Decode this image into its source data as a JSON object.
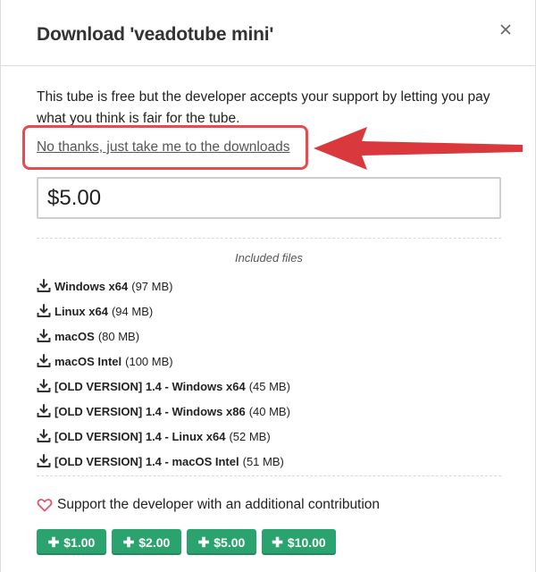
{
  "dialog": {
    "title": "Download 'veadotube mini'",
    "close_icon": "close-icon",
    "description": "This tube is free but the developer accepts your support by letting you pay what you think is fair for the tube.",
    "skip_link": "No thanks, just take me to the downloads",
    "price_value": "$5.00",
    "annotation_color": "#e84a4f"
  },
  "files": {
    "label": "Included files",
    "icon": "download-icon",
    "items": [
      {
        "name": "Windows x64",
        "size": "(97 MB)"
      },
      {
        "name": "Linux x64",
        "size": "(94 MB)"
      },
      {
        "name": "macOS",
        "size": "(80 MB)"
      },
      {
        "name": "macOS Intel",
        "size": "(100 MB)"
      },
      {
        "name": "[OLD VERSION] 1.4 - Windows x64",
        "size": "(45 MB)"
      },
      {
        "name": "[OLD VERSION] 1.4 - Windows x86",
        "size": "(40 MB)"
      },
      {
        "name": "[OLD VERSION] 1.4 - Linux x64",
        "size": "(52 MB)"
      },
      {
        "name": "[OLD VERSION] 1.4 - macOS Intel",
        "size": "(51 MB)"
      }
    ]
  },
  "support": {
    "icon": "heart-icon",
    "text": "Support the developer with an additional contribution",
    "accent_color": "#2ba36e",
    "buttons": [
      {
        "label": "$1.00"
      },
      {
        "label": "$2.00"
      },
      {
        "label": "$5.00"
      },
      {
        "label": "$10.00"
      }
    ]
  }
}
